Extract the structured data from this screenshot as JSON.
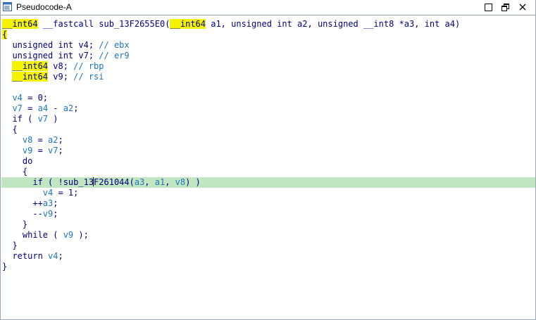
{
  "window": {
    "title": "Pseudocode-A",
    "minimize_glyph": "□",
    "restore_glyph": "🗗",
    "close_glyph": "✕"
  },
  "code": {
    "lines": [
      {
        "tokens": [
          {
            "t": "__int64",
            "c": "hl"
          },
          {
            "t": " __fastcall sub_13F2655E0(",
            "c": "plain"
          },
          {
            "t": "__int64",
            "c": "hl"
          },
          {
            "t": " a1, unsigned int a2, unsigned __int8 *a3, int a4)",
            "c": "plain"
          }
        ]
      },
      {
        "tokens": [
          {
            "t": "{",
            "c": "hl"
          }
        ]
      },
      {
        "tokens": [
          {
            "t": "  unsigned int v4; ",
            "c": "plain"
          },
          {
            "t": "// ebx",
            "c": "cmt"
          }
        ]
      },
      {
        "tokens": [
          {
            "t": "  unsigned int v7; ",
            "c": "plain"
          },
          {
            "t": "// er9",
            "c": "cmt"
          }
        ]
      },
      {
        "tokens": [
          {
            "t": "  ",
            "c": "plain"
          },
          {
            "t": "__int64",
            "c": "hl"
          },
          {
            "t": " v8; ",
            "c": "plain"
          },
          {
            "t": "// rbp",
            "c": "cmt"
          }
        ]
      },
      {
        "tokens": [
          {
            "t": "  ",
            "c": "plain"
          },
          {
            "t": "__int64",
            "c": "hl"
          },
          {
            "t": " v9; ",
            "c": "plain"
          },
          {
            "t": "// rsi",
            "c": "cmt"
          }
        ]
      },
      {
        "tokens": [
          {
            "t": "",
            "c": "plain"
          }
        ]
      },
      {
        "tokens": [
          {
            "t": "  ",
            "c": "plain"
          },
          {
            "t": "v4",
            "c": "var"
          },
          {
            "t": " = 0;",
            "c": "plain"
          }
        ]
      },
      {
        "tokens": [
          {
            "t": "  ",
            "c": "plain"
          },
          {
            "t": "v7",
            "c": "var"
          },
          {
            "t": " = ",
            "c": "plain"
          },
          {
            "t": "a4",
            "c": "var"
          },
          {
            "t": " - ",
            "c": "plain"
          },
          {
            "t": "a2",
            "c": "var"
          },
          {
            "t": ";",
            "c": "plain"
          }
        ]
      },
      {
        "tokens": [
          {
            "t": "  if ( ",
            "c": "plain"
          },
          {
            "t": "v7",
            "c": "var"
          },
          {
            "t": " )",
            "c": "plain"
          }
        ]
      },
      {
        "tokens": [
          {
            "t": "  {",
            "c": "plain"
          }
        ]
      },
      {
        "tokens": [
          {
            "t": "    ",
            "c": "plain"
          },
          {
            "t": "v8",
            "c": "var"
          },
          {
            "t": " = ",
            "c": "plain"
          },
          {
            "t": "a2",
            "c": "var"
          },
          {
            "t": ";",
            "c": "plain"
          }
        ]
      },
      {
        "tokens": [
          {
            "t": "    ",
            "c": "plain"
          },
          {
            "t": "v9",
            "c": "var"
          },
          {
            "t": " = ",
            "c": "plain"
          },
          {
            "t": "v7",
            "c": "var"
          },
          {
            "t": ";",
            "c": "plain"
          }
        ]
      },
      {
        "tokens": [
          {
            "t": "    do",
            "c": "plain"
          }
        ]
      },
      {
        "tokens": [
          {
            "t": "    {",
            "c": "plain"
          }
        ]
      },
      {
        "current": true,
        "tokens": [
          {
            "t": "      if ( !sub_13",
            "c": "plain"
          },
          {
            "t": "|",
            "c": "caret"
          },
          {
            "t": "F261044(",
            "c": "plain"
          },
          {
            "t": "a3",
            "c": "var"
          },
          {
            "t": ", ",
            "c": "plain"
          },
          {
            "t": "a1",
            "c": "var"
          },
          {
            "t": ", ",
            "c": "plain"
          },
          {
            "t": "v8",
            "c": "var"
          },
          {
            "t": ") )",
            "c": "plain"
          }
        ]
      },
      {
        "tokens": [
          {
            "t": "        ",
            "c": "plain"
          },
          {
            "t": "v4",
            "c": "var"
          },
          {
            "t": " = 1;",
            "c": "plain"
          }
        ]
      },
      {
        "tokens": [
          {
            "t": "      ++",
            "c": "plain"
          },
          {
            "t": "a3",
            "c": "var"
          },
          {
            "t": ";",
            "c": "plain"
          }
        ]
      },
      {
        "tokens": [
          {
            "t": "      --",
            "c": "plain"
          },
          {
            "t": "v9",
            "c": "var"
          },
          {
            "t": ";",
            "c": "plain"
          }
        ]
      },
      {
        "tokens": [
          {
            "t": "    }",
            "c": "plain"
          }
        ]
      },
      {
        "tokens": [
          {
            "t": "    while ( ",
            "c": "plain"
          },
          {
            "t": "v9",
            "c": "var"
          },
          {
            "t": " );",
            "c": "plain"
          }
        ]
      },
      {
        "tokens": [
          {
            "t": "  }",
            "c": "plain"
          }
        ]
      },
      {
        "tokens": [
          {
            "t": "  return ",
            "c": "plain"
          },
          {
            "t": "v4",
            "c": "var"
          },
          {
            "t": ";",
            "c": "plain"
          }
        ]
      },
      {
        "tokens": [
          {
            "t": "}",
            "c": "plain"
          }
        ]
      }
    ]
  },
  "colors": {
    "highlight": "#f4f400",
    "current_line": "#c2e6c2",
    "identifier": "#1c76bf",
    "keyword_text": "#000080"
  }
}
